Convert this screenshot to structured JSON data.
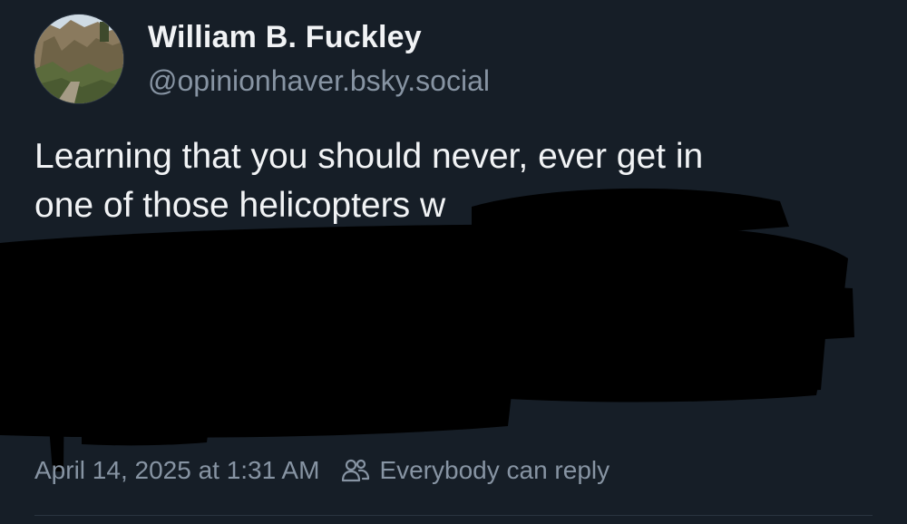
{
  "author": {
    "display_name": "William B. Fuckley",
    "handle": "@opinionhaver.bsky.social",
    "avatar_icon": "avatar-cliff-photo"
  },
  "post": {
    "lines": [
      "Learning that you should never, ever get in",
      "one of those helicopters w",
      "",
      "",
      ""
    ],
    "redacted": true
  },
  "meta": {
    "timestamp": "April 14, 2025 at 1:31 AM",
    "reply_icon": "people-icon",
    "reply_setting": "Everybody can reply"
  },
  "colors": {
    "background": "#161e27",
    "text": "#f1f3f5",
    "muted": "#8794a3",
    "divider": "#2a3440",
    "redaction": "#000000"
  }
}
